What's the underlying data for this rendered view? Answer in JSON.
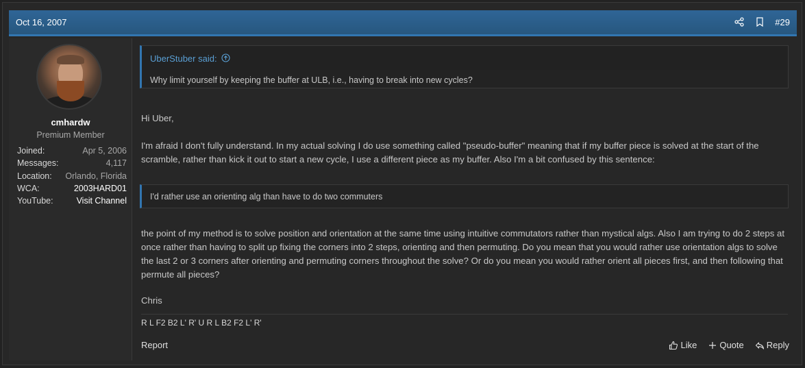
{
  "post": {
    "date": "Oct 16, 2007",
    "number": "#29",
    "icons": {
      "share": "share-icon",
      "bookmark": "bookmark-icon"
    }
  },
  "user": {
    "name": "cmhardw",
    "title": "Premium Member",
    "stats": [
      {
        "label": "Joined:",
        "value": "Apr 5, 2006"
      },
      {
        "label": "Messages:",
        "value": "4,117"
      },
      {
        "label": "Location:",
        "value": "Orlando, Florida"
      },
      {
        "label": "WCA:",
        "value": "2003HARD01"
      },
      {
        "label": "YouTube:",
        "value": "Visit Channel"
      }
    ]
  },
  "quote1": {
    "author": "UberStuber said:",
    "text": "Why limit yourself by keeping the buffer at ULB, i.e., having to break into new cycles?"
  },
  "body": {
    "p1": "Hi Uber,",
    "p2": "I'm afraid I don't fully understand. In my actual solving I do use something called \"pseudo-buffer\" meaning that if my buffer piece is solved at the start of the scramble, rather than kick it out to start a new cycle, I use a different piece as my buffer. Also I'm a bit confused by this sentence:",
    "quote2": "I'd rather use an orienting alg than have to do two commuters",
    "p3": "the point of my method is to solve position and orientation at the same time using intuitive commutators rather than mystical algs. Also I am trying to do 2 steps at once rather than having to split up fixing the corners into 2 steps, orienting and then permuting. Do you mean that you would rather use orientation algs to solve the last 2 or 3 corners after orienting and permuting corners throughout the solve? Or do you mean you would rather orient all pieces first, and then following that permute all pieces?",
    "p4": "Chris"
  },
  "signature": "R L F2 B2 L' R' U R L B2 F2 L' R'",
  "actions": {
    "report": "Report",
    "like": "Like",
    "quote": "Quote",
    "reply": "Reply"
  },
  "colors": {
    "header": "#2f6596",
    "accent": "#3276b1",
    "link": "#5a9fd4",
    "background": "#272727"
  }
}
